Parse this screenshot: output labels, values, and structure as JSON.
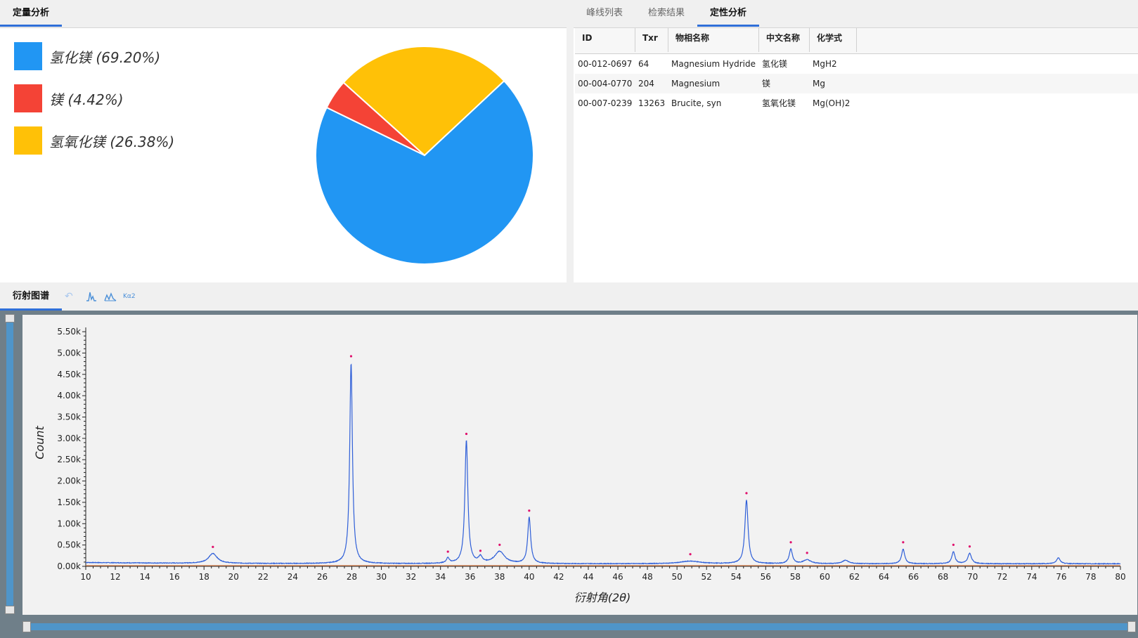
{
  "quant_panel": {
    "tab_label": "定量分析"
  },
  "legend": [
    {
      "label": "氢化镁 (69.20%)",
      "color": "#2196f3"
    },
    {
      "label": "镁 (4.42%)",
      "color": "#f44336"
    },
    {
      "label": "氢氧化镁 (26.38%)",
      "color": "#ffc107"
    }
  ],
  "right_tabs": [
    {
      "label": "峰线列表"
    },
    {
      "label": "检索结果"
    },
    {
      "label": "定性分析"
    }
  ],
  "phase_table": {
    "headers": [
      "ID",
      "Txr",
      "物相名称",
      "中文名称",
      "化学式"
    ],
    "rows": [
      [
        "00-012-0697",
        "64",
        "Magnesium Hydride",
        "氢化镁",
        "MgH2"
      ],
      [
        "00-004-0770",
        "204",
        "Magnesium",
        "镁",
        "Mg"
      ],
      [
        "00-007-0239",
        "13263",
        "Brucite, syn",
        "氢氧化镁",
        "Mg(OH)2"
      ]
    ]
  },
  "diffraction_panel": {
    "tab_label": "衍射图谱",
    "toolbar_icons": [
      "undo-icon",
      "peak-icon",
      "multi-peak-icon",
      "ka2-icon"
    ],
    "ka2_label": "Kα2"
  },
  "chart_data": [
    {
      "type": "pie",
      "categories": [
        "氢化镁",
        "镁",
        "氢氧化镁"
      ],
      "values": [
        69.2,
        4.42,
        26.38
      ],
      "colors": [
        "#2196f3",
        "#f44336",
        "#ffc107"
      ]
    },
    {
      "type": "line",
      "xlabel": "衍射角(2θ)",
      "ylabel": "Count",
      "xlim": [
        10,
        80
      ],
      "ylim": [
        0,
        5600
      ],
      "x_ticks": [
        "10",
        "12",
        "14",
        "16",
        "18",
        "20",
        "22",
        "24",
        "26",
        "28",
        "30",
        "32",
        "34",
        "36",
        "38",
        "40",
        "42",
        "44",
        "46",
        "48",
        "50",
        "52",
        "54",
        "56",
        "58",
        "60",
        "62",
        "64",
        "66",
        "68",
        "70",
        "72",
        "74",
        "76",
        "78",
        "80"
      ],
      "y_ticks": [
        "0.00k",
        "0.50k",
        "1.00k",
        "1.50k",
        "2.00k",
        "2.50k",
        "3.00k",
        "3.50k",
        "4.00k",
        "4.50k",
        "5.00k",
        "5.50k"
      ],
      "baseline": 60,
      "peaks": [
        {
          "x": 18.6,
          "height": 230,
          "width": 0.35
        },
        {
          "x": 27.95,
          "height": 4700,
          "width": 0.11
        },
        {
          "x": 34.5,
          "height": 120,
          "width": 0.12
        },
        {
          "x": 35.75,
          "height": 2880,
          "width": 0.12
        },
        {
          "x": 36.7,
          "height": 140,
          "width": 0.15
        },
        {
          "x": 38.0,
          "height": 280,
          "width": 0.4
        },
        {
          "x": 40.0,
          "height": 1080,
          "width": 0.12
        },
        {
          "x": 50.9,
          "height": 60,
          "width": 0.8
        },
        {
          "x": 54.7,
          "height": 1490,
          "width": 0.13
        },
        {
          "x": 57.7,
          "height": 340,
          "width": 0.13
        },
        {
          "x": 58.8,
          "height": 90,
          "width": 0.3
        },
        {
          "x": 61.4,
          "height": 80,
          "width": 0.25
        },
        {
          "x": 65.3,
          "height": 340,
          "width": 0.13
        },
        {
          "x": 68.7,
          "height": 280,
          "width": 0.13
        },
        {
          "x": 69.8,
          "height": 240,
          "width": 0.15
        },
        {
          "x": 75.8,
          "height": 140,
          "width": 0.15
        }
      ],
      "markers": [
        18.6,
        27.95,
        34.5,
        35.75,
        36.7,
        38.0,
        40.0,
        50.9,
        54.7,
        57.7,
        58.8,
        65.3,
        68.7,
        69.8
      ],
      "line_color": "#2f5fd8",
      "marker_color": "#e0116d",
      "baseline_color": "#e0763a"
    }
  ]
}
